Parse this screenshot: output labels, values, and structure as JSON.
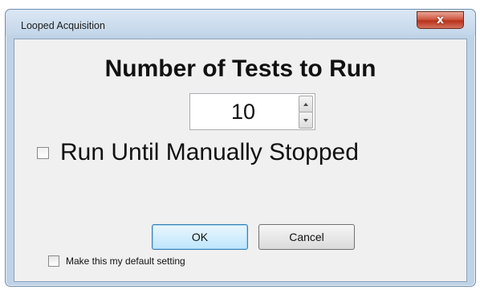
{
  "window": {
    "title": "Looped Acquisition",
    "close_label": "x"
  },
  "main": {
    "heading": "Number of Tests to Run",
    "tests_count": "10",
    "run_until_stopped_label": "Run Until Manually Stopped",
    "run_until_stopped_checked": false,
    "ok_label": "OK",
    "cancel_label": "Cancel",
    "default_setting_label": "Make this my default setting",
    "default_setting_checked": false
  },
  "icons": {
    "close": "close-icon",
    "spin_up": "chevron-up-icon",
    "spin_down": "chevron-down-icon"
  }
}
